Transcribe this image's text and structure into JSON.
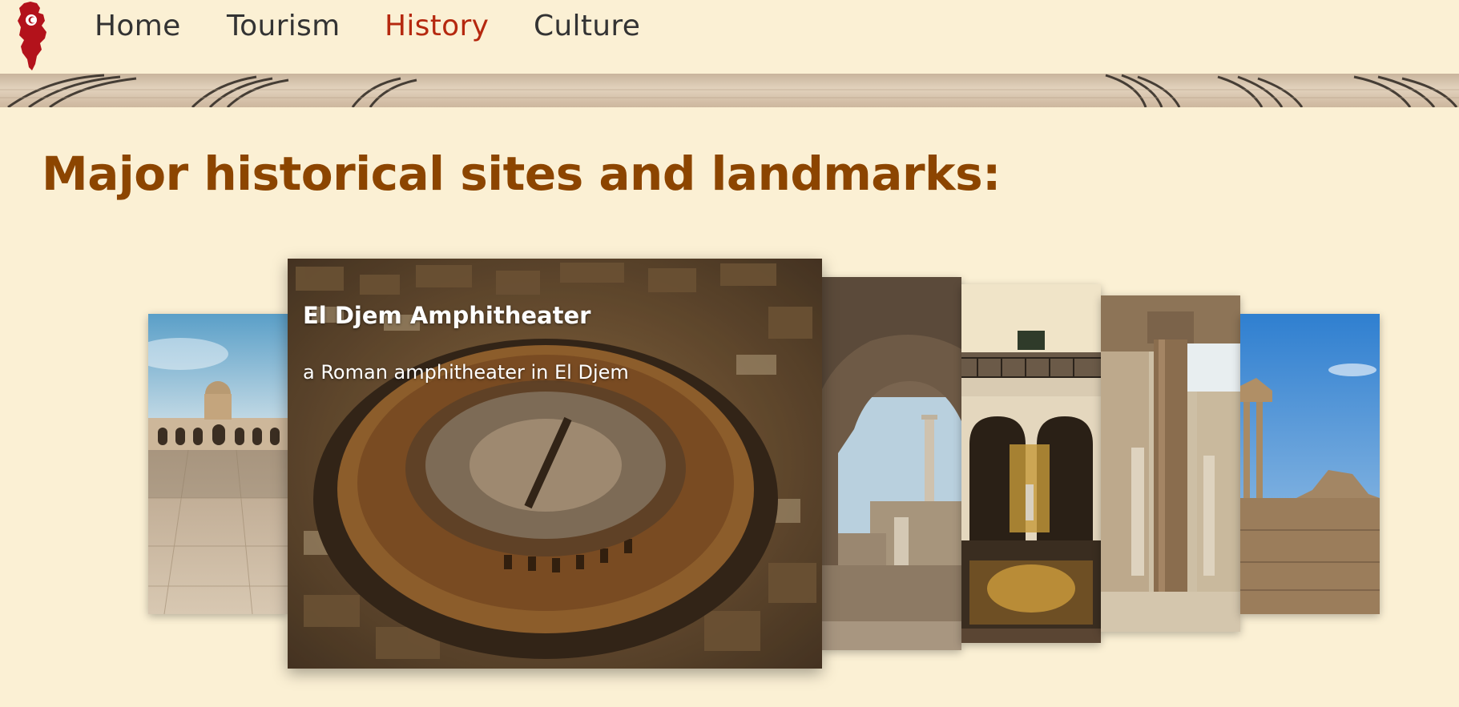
{
  "nav": {
    "links": [
      {
        "label": "Home",
        "active": false
      },
      {
        "label": "Tourism",
        "active": false
      },
      {
        "label": "History",
        "active": true
      },
      {
        "label": "Culture",
        "active": false
      }
    ],
    "active_color": "#b5280f",
    "link_color": "#333333"
  },
  "logo": {
    "icon": "tunisia-map-flag-icon",
    "color": "#b3121b"
  },
  "page": {
    "heading": "Major historical sites and landmarks:",
    "heading_color": "#8c4500",
    "background": "#fbf0d4"
  },
  "carousel": {
    "active_index": 1,
    "cards": [
      {
        "image": "kairouan-great-mosque-photo"
      },
      {
        "image": "el-djem-amphitheater-photo",
        "title": "El Djem Amphitheater",
        "description": "a Roman amphitheater in El Djem"
      },
      {
        "image": "carthage-ruins-arch-photo"
      },
      {
        "image": "bardo-museum-courtyard-photo"
      },
      {
        "image": "roman-villa-column-photo"
      },
      {
        "image": "dougga-temple-ruins-photo"
      }
    ]
  }
}
